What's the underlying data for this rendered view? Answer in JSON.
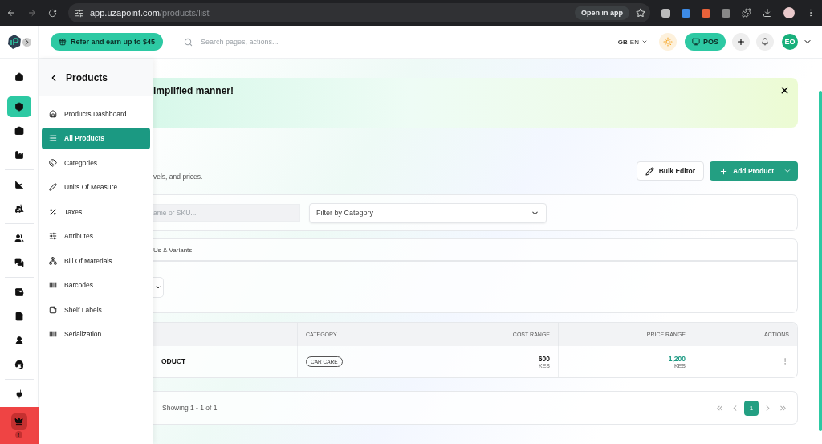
{
  "browser": {
    "address": {
      "host": "app.uzapoint.com",
      "path": "/products/list"
    },
    "open_in_app": "Open in app"
  },
  "header": {
    "refer": "Refer and earn up to $45",
    "search": {
      "placeholder": "Search pages, actions..."
    },
    "flag": "GB",
    "language": "EN",
    "pos": "POS",
    "avatar": "EO"
  },
  "rail": {
    "items": [
      {
        "selected": false
      },
      {
        "selected": true
      },
      {
        "selected": false
      },
      {
        "selected": false
      },
      {
        "selected": false
      },
      {
        "selected": false
      },
      {
        "selected": false
      },
      {
        "selected": false
      },
      {
        "selected": false
      },
      {
        "selected": false
      },
      {
        "selected": false
      },
      {
        "selected": false
      },
      {
        "selected": false
      }
    ],
    "badge": "!"
  },
  "submenu": {
    "title": "Products",
    "items": [
      {
        "label": "Products Dashboard",
        "selected": false
      },
      {
        "label": "All Products",
        "selected": true
      },
      {
        "label": "Categories",
        "selected": false
      },
      {
        "label": "Units Of Measure",
        "selected": false
      },
      {
        "label": "Taxes",
        "selected": false
      },
      {
        "label": "Attributes",
        "selected": false
      },
      {
        "label": "Bill Of Materials",
        "selected": false
      },
      {
        "label": "Barcodes",
        "selected": false
      },
      {
        "label": "Shelf Labels",
        "selected": false
      },
      {
        "label": "Serialization",
        "selected": false
      }
    ]
  },
  "banner": {
    "title": "implified manner!"
  },
  "page": {
    "subtitle": "vels, and prices.",
    "buttons": [
      "Bulk Editor",
      "Add Product"
    ]
  },
  "filters": {
    "search": {
      "placeholder": "ame or SKU..."
    },
    "category": {
      "placeholder": "Filter by Category"
    }
  },
  "section_tab": "Us & Variants",
  "table": {
    "columns": [
      "",
      "CATEGORY",
      "COST RANGE",
      "PRICE RANGE",
      "ACTIONS"
    ],
    "rows": [
      {
        "product": "ODUCT",
        "category": "CAR CARE",
        "cost": "600",
        "cost_currency": "KES",
        "price": "1,200",
        "price_currency": "KES"
      }
    ]
  },
  "pagination": {
    "summary": "Showing 1 - 1 of 1",
    "pages": [
      {
        "label": "1",
        "selected": true
      }
    ]
  }
}
